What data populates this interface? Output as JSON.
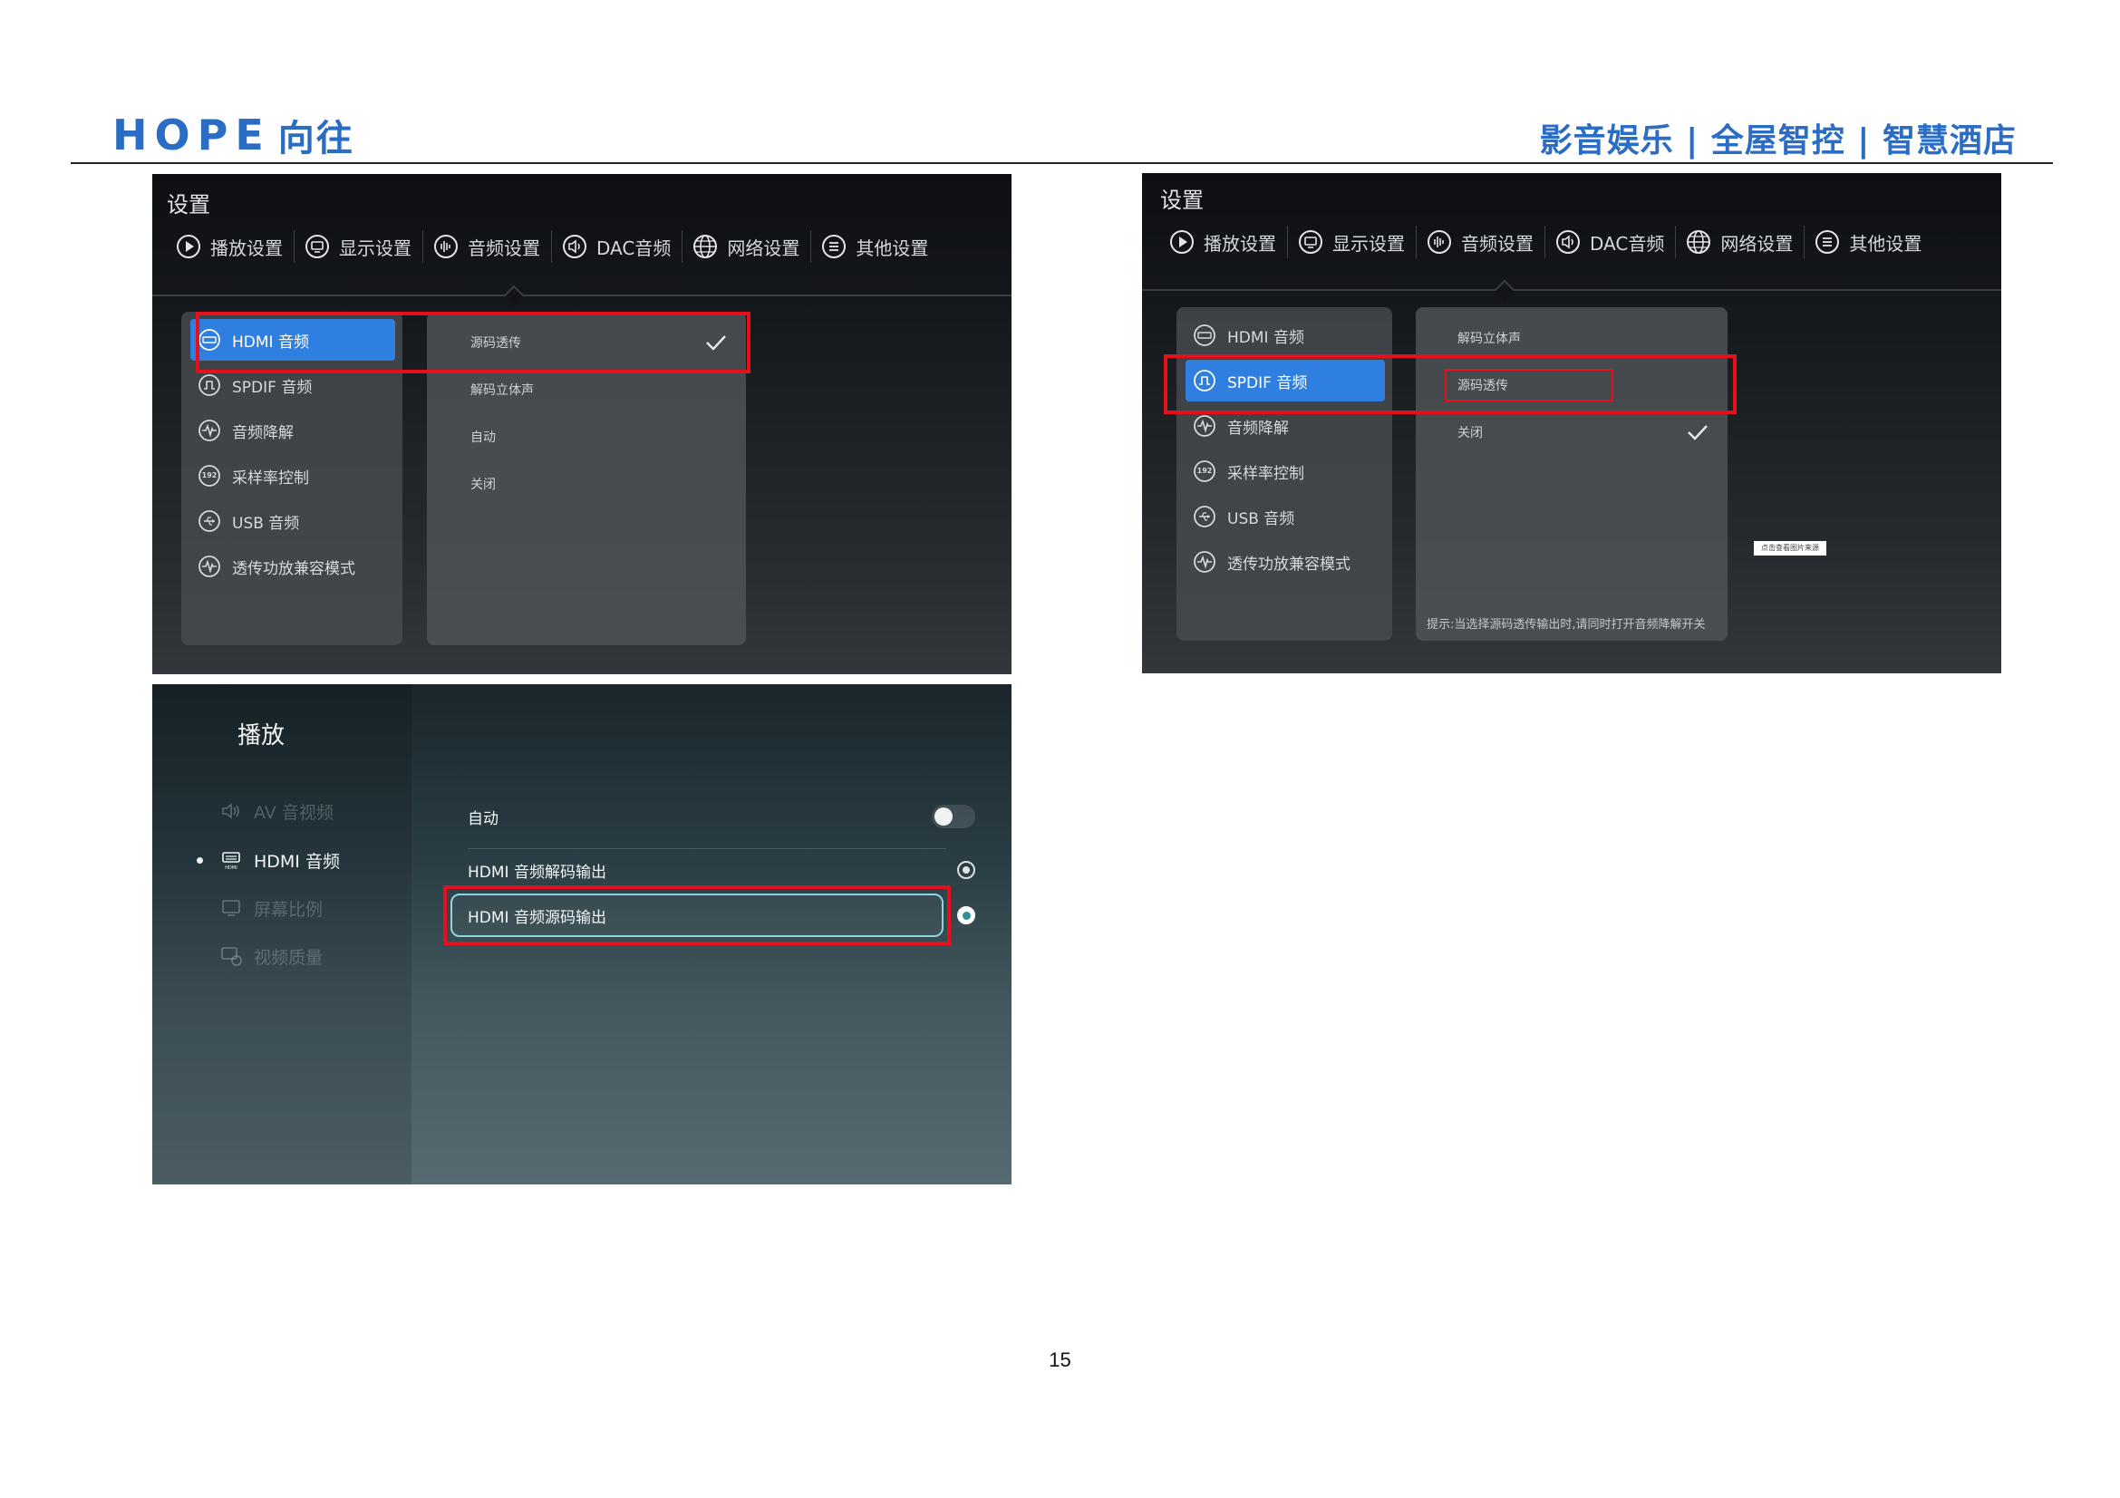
{
  "header": {
    "logo_latin": "HOPE",
    "logo_chinese": "向往",
    "slogan": "影音娱乐 | 全屋智控 | 智慧酒店"
  },
  "page_number": "15",
  "settings_nav": {
    "title": "设置",
    "tabs": [
      {
        "label": "播放设置",
        "icon": "play-circle-icon"
      },
      {
        "label": "显示设置",
        "icon": "monitor-icon"
      },
      {
        "label": "音频设置",
        "icon": "audio-wave-icon"
      },
      {
        "label": "DAC音频",
        "icon": "speaker-icon"
      },
      {
        "label": "网络设置",
        "icon": "globe-icon"
      },
      {
        "label": "其他设置",
        "icon": "menu-lines-icon"
      }
    ]
  },
  "shot1": {
    "left_menu": [
      {
        "label": "HDMI 音频",
        "icon": "hdmi-icon",
        "active": true
      },
      {
        "label": "SPDIF 音频",
        "icon": "spdif-icon",
        "active": false
      },
      {
        "label": "音频降解",
        "icon": "waveform-icon",
        "active": false
      },
      {
        "label": "采样率控制",
        "icon": "sample-rate-192-icon",
        "active": false
      },
      {
        "label": "USB 音频",
        "icon": "usb-icon",
        "active": false
      },
      {
        "label": "透传功放兼容模式",
        "icon": "waveform-icon",
        "active": false
      }
    ],
    "options": [
      {
        "label": "源码透传",
        "checked": true
      },
      {
        "label": "解码立体声",
        "checked": false
      },
      {
        "label": "自动",
        "checked": false
      },
      {
        "label": "关闭",
        "checked": false
      }
    ]
  },
  "shot2": {
    "left_menu": [
      {
        "label": "HDMI 音频",
        "icon": "hdmi-icon",
        "active": false
      },
      {
        "label": "SPDIF 音频",
        "icon": "spdif-icon",
        "active": true
      },
      {
        "label": "音频降解",
        "icon": "waveform-icon",
        "active": false
      },
      {
        "label": "采样率控制",
        "icon": "sample-rate-192-icon",
        "active": false
      },
      {
        "label": "USB 音频",
        "icon": "usb-icon",
        "active": false
      },
      {
        "label": "透传功放兼容模式",
        "icon": "waveform-icon",
        "active": false
      }
    ],
    "options": [
      {
        "label": "解码立体声",
        "checked": false
      },
      {
        "label": "源码透传",
        "checked": false
      },
      {
        "label": "关闭",
        "checked": true
      }
    ],
    "hint": "提示:当选择源码透传输出时,请同时打开音频降解开关",
    "floating_tag": "点击查看图片来源"
  },
  "shot3": {
    "title": "播放",
    "side_items": [
      {
        "label": "AV 音视频",
        "icon": "speaker-icon",
        "state": "dim"
      },
      {
        "label": "HDMI 音频",
        "icon": "hdmi-icon",
        "state": "current"
      },
      {
        "label": "屏幕比例",
        "icon": "screen-ratio-icon",
        "state": "dim"
      },
      {
        "label": "视频质量",
        "icon": "video-quality-icon",
        "state": "dim"
      }
    ],
    "rows": [
      {
        "label": "自动",
        "control": "toggle",
        "on": false
      },
      {
        "label": "HDMI 音频解码输出",
        "control": "radio",
        "selected": false
      },
      {
        "label": "HDMI 音频源码输出",
        "control": "radio",
        "selected": true
      }
    ]
  },
  "colors": {
    "brand_blue": "#2b6cc4",
    "highlight_red": "#e5101c",
    "active_menu_blue": "#2f7fe0",
    "selected_outline": "#8fd6da"
  }
}
